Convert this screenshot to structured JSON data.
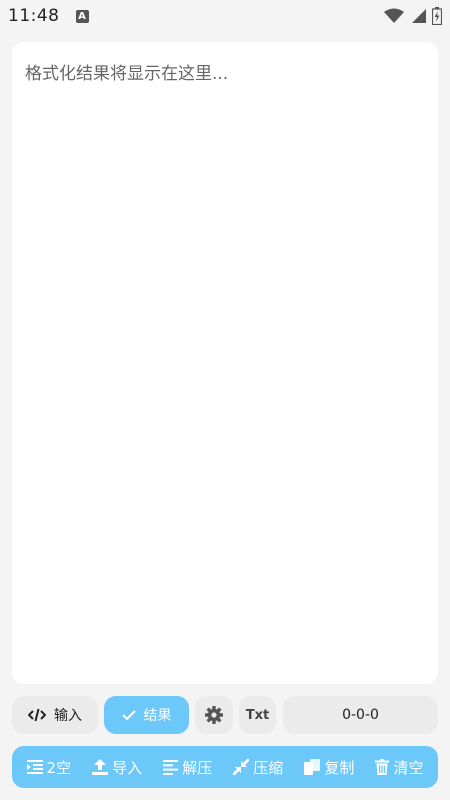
{
  "status_bar": {
    "time": "11:48",
    "notification_icon_letter": "A",
    "icons": [
      "wifi-icon",
      "signal-icon",
      "battery-icon"
    ]
  },
  "result": {
    "placeholder": "格式化结果将显示在这里..."
  },
  "toolbar_top": {
    "input_label": "输入",
    "result_label": "结果",
    "txt_label": "Txt",
    "counter": "0-0-0",
    "active_tab": "结果",
    "accent_color": "#6cc8f9"
  },
  "toolbar_bottom": {
    "items": [
      {
        "label": "2空",
        "icon": "indent-icon"
      },
      {
        "label": "导入",
        "icon": "upload-icon"
      },
      {
        "label": "解压",
        "icon": "align-left-icon"
      },
      {
        "label": "压缩",
        "icon": "compress-icon"
      },
      {
        "label": "复制",
        "icon": "copy-icon"
      },
      {
        "label": "清空",
        "icon": "trash-icon"
      }
    ]
  }
}
